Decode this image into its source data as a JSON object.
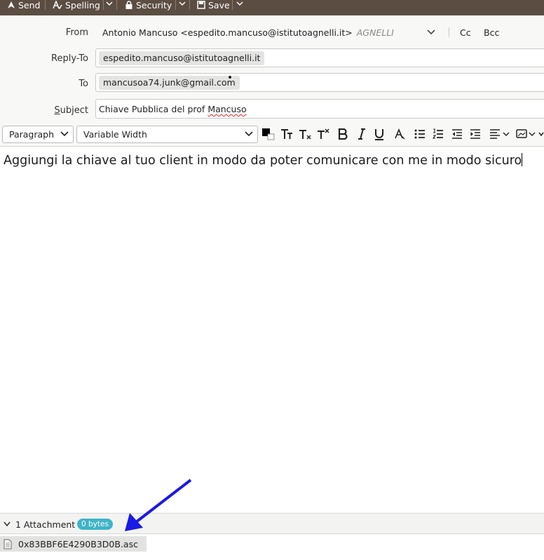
{
  "toolbar": {
    "send_label": "Send",
    "spelling_label": "Spelling",
    "security_label": "Security",
    "save_label": "Save"
  },
  "header": {
    "from_label": "From",
    "from_value": "Antonio Mancuso <espedito.mancuso@istitutoagnelli.it>",
    "from_identity": "AGNELLI",
    "cc_label": "Cc",
    "bcc_label": "Bcc",
    "reply_to_label": "Reply-To",
    "reply_to_value": "espedito.mancuso@istitutoagnelli.it",
    "to_label": "To",
    "to_value": "mancusoa74.junk@gmail.com",
    "subject_label": "Subject",
    "subject_prefix": "Chiave Pubblica del prof ",
    "subject_misspelled": "Mancuso"
  },
  "format": {
    "paragraph_label": "Paragraph",
    "font_label": "Variable Width"
  },
  "editor": {
    "body": "Aggiungi la chiave al tuo client in modo da poter comunicare con me in modo sicuro"
  },
  "attachments": {
    "title": "1 Attachment",
    "size_badge": "0 bytes",
    "items": [
      {
        "name": "0x83BBF6E4290B3D0B.asc"
      }
    ]
  },
  "colors": {
    "toolbar_bg": "#5b4d42",
    "badge_bg": "#3fb4c6",
    "annotation_arrow": "#1a1ae6"
  }
}
